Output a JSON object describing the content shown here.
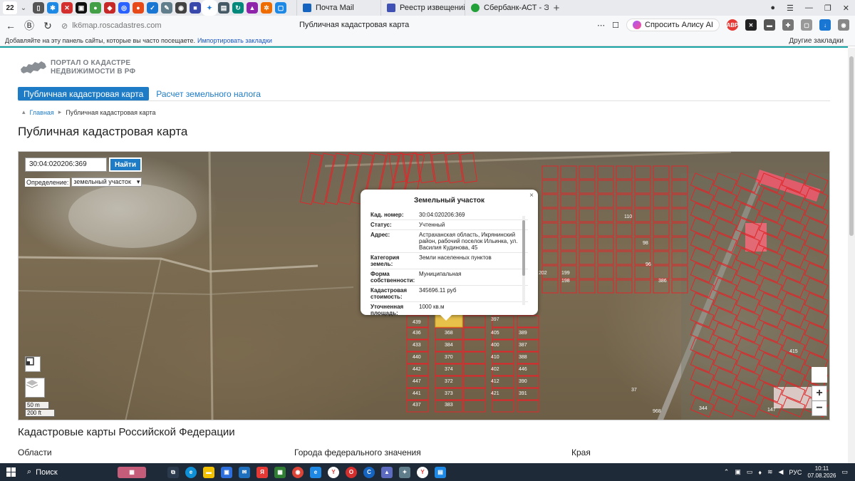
{
  "browser": {
    "tab_count": "22",
    "tabs": [
      {
        "title": "Почта Mail",
        "color": "#1565c0"
      },
      {
        "title": "Реестр извещений",
        "color": "#3f51b5"
      },
      {
        "title": "Сбербанк-АСТ - Электрон",
        "color": "#21a038"
      }
    ],
    "new_tab_icon": "plus-icon",
    "url": "lk6map.roscadastres.com",
    "page_title": "Публичная кадастровая карта",
    "alice_label": "Спросить Алису AI",
    "bookmarks_prompt": "Добавляйте на эту панель сайты, которые вы часто посещаете.",
    "bookmarks_import": "Импортировать закладки",
    "bookmarks_other": "Другие закладки"
  },
  "site": {
    "logo_line1": "ПОРТАЛ О КАДАСТРЕ",
    "logo_line2": "НЕДВИЖИМОСТИ В РФ",
    "menu_active": "Публичная кадастровая карта",
    "menu_item": "Расчет земельного налога",
    "breadcrumb_home": "Главная",
    "breadcrumb_current": "Публичная кадастровая карта",
    "heading": "Публичная кадастровая карта"
  },
  "map": {
    "search_value": "30:04:020206:369",
    "find_label": "Найти",
    "definition_label": "Определение:",
    "definition_value": "земельный участок",
    "scale_m": "50 m",
    "scale_ft": "200 ft",
    "zoom_in": "+",
    "zoom_out": "−",
    "highlight_color": "#e8c14a",
    "parcel_color": "#e0262a",
    "parcel_labels": [
      "369",
      "368",
      "384",
      "370",
      "374",
      "372",
      "373",
      "383",
      "439",
      "436",
      "433",
      "440",
      "442",
      "447",
      "441",
      "437",
      "397",
      "405",
      "400",
      "410",
      "402",
      "412",
      "421",
      "389",
      "387",
      "388",
      "446",
      "390",
      "391",
      "202",
      "199",
      "198",
      "110",
      "98",
      "96",
      "386",
      "415",
      "968",
      "344",
      "147",
      "37"
    ]
  },
  "popup": {
    "title": "Земельный участок",
    "close": "×",
    "rows": [
      {
        "key": "Кад. номер:",
        "value": "30:04:020206:369"
      },
      {
        "key": "Статус:",
        "value": "Учтенный"
      },
      {
        "key": "Адрес:",
        "value": "Астраханская область, Икрянинский район, рабочий поселок Ильинка, ул. Василия Кудинова, 45"
      },
      {
        "key": "Категория земель:",
        "value": "Земли населенных пунктов"
      },
      {
        "key": "Форма собственности:",
        "value": "Муниципальная"
      },
      {
        "key": "Кадастровая стоимость:",
        "value": "345696.11 руб"
      },
      {
        "key": "Уточненная площадь:",
        "value": "1000 кв.м"
      }
    ]
  },
  "sections": {
    "title": "Кадастровые карты Российской Федерации",
    "col1": "Области",
    "col2": "Города федерального значения",
    "col3": "Края"
  },
  "taskbar": {
    "search": "Поиск",
    "lang": "РУС",
    "time": "10:11",
    "date": "07.08.2026"
  }
}
